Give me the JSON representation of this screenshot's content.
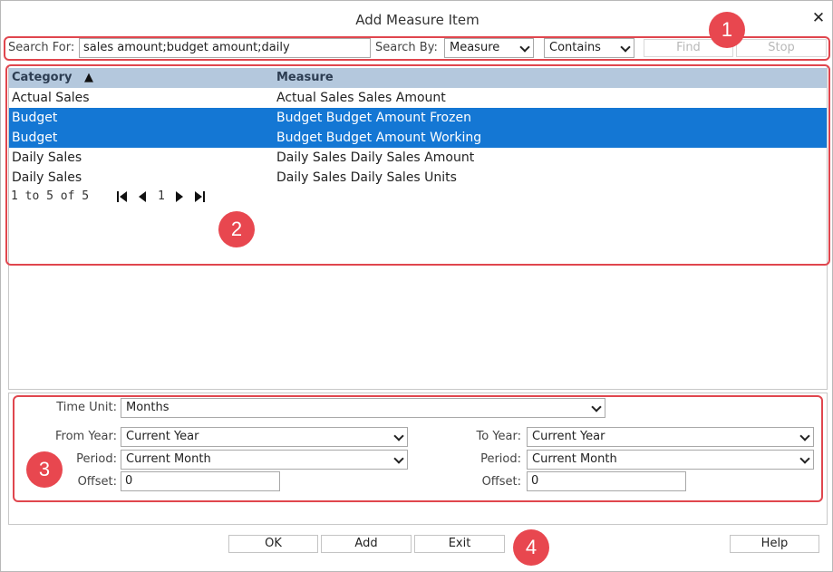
{
  "dialog": {
    "title": "Add Measure Item",
    "close_glyph": "✕"
  },
  "callouts": [
    "1",
    "2",
    "3",
    "4"
  ],
  "search": {
    "label": "Search For:",
    "value": "sales amount;budget amount;daily",
    "by_label": "Search By:",
    "by_value": "Measure",
    "match_value": "Contains",
    "find_label": "Find",
    "stop_label": "Stop"
  },
  "grid": {
    "columns": [
      {
        "label": "Category",
        "sort_icon": "▲"
      },
      {
        "label": "Measure"
      }
    ],
    "rows": [
      {
        "category": "Actual Sales",
        "measure": "Actual Sales Sales Amount",
        "selected": false
      },
      {
        "category": "Budget",
        "measure": "Budget Budget Amount Frozen",
        "selected": true
      },
      {
        "category": "Budget",
        "measure": "Budget Budget Amount Working",
        "selected": true
      },
      {
        "category": "Daily Sales",
        "measure": "Daily Sales Daily Sales Amount",
        "selected": false
      },
      {
        "category": "Daily Sales",
        "measure": "Daily Sales Daily Sales Units",
        "selected": false
      }
    ],
    "pager": {
      "summary": "1 to 5 of 5",
      "page": "1"
    }
  },
  "time": {
    "unit_label": "Time Unit:",
    "unit_value": "Months",
    "from_year_label": "From Year:",
    "from_year_value": "Current Year",
    "from_period_label": "Period:",
    "from_period_value": "Current Month",
    "from_offset_label": "Offset:",
    "from_offset_value": "0",
    "to_year_label": "To Year:",
    "to_year_value": "Current Year",
    "to_period_label": "Period:",
    "to_period_value": "Current Month",
    "to_offset_label": "Offset:",
    "to_offset_value": "0"
  },
  "footer": {
    "ok_label": "OK",
    "add_label": "Add",
    "exit_label": "Exit",
    "help_label": "Help"
  },
  "colors": {
    "selection": "#1477d4",
    "header": "#b4c8dd",
    "callout": "#e8474f"
  }
}
